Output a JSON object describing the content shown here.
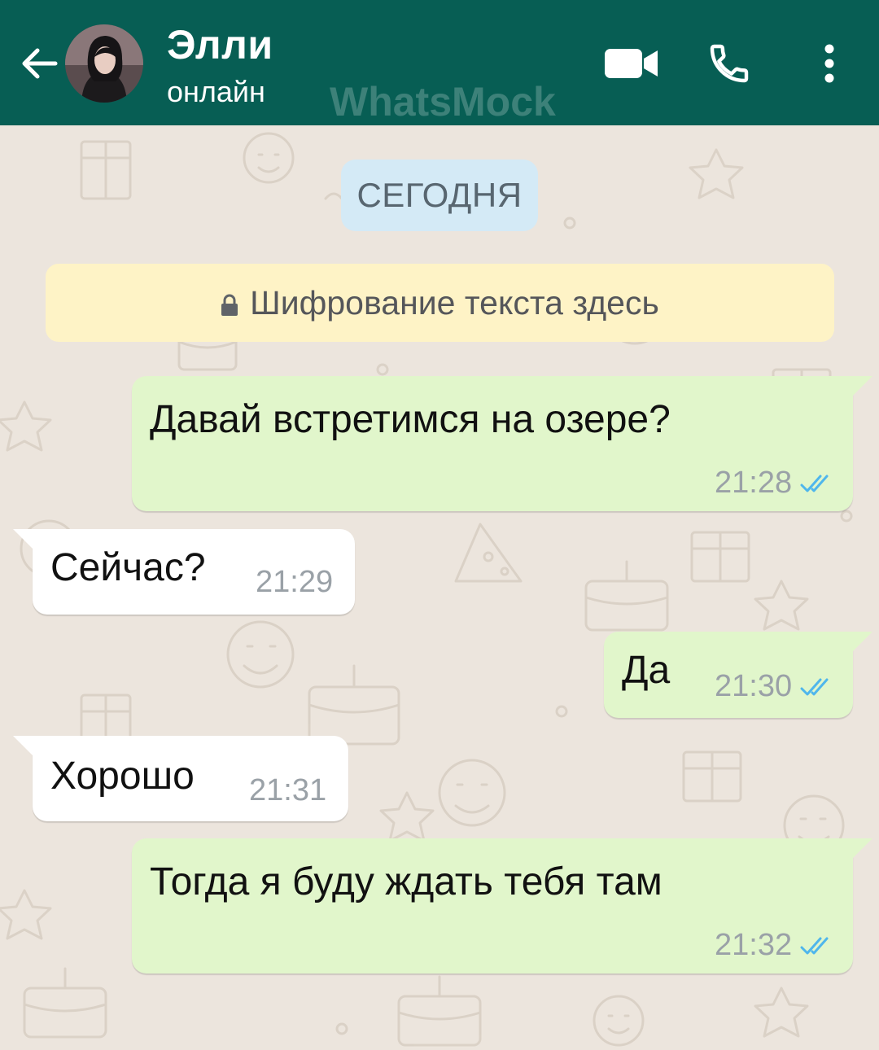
{
  "header": {
    "contact_name": "Элли",
    "contact_status": "онлайн",
    "watermark": "WhatsMock",
    "icons": [
      "back-arrow-icon",
      "avatar",
      "video-call-icon",
      "phone-icon",
      "more-vert-icon"
    ]
  },
  "chat": {
    "date_label": "СЕГОДНЯ",
    "encryption_notice": "Шифрование текста здесь",
    "messages": [
      {
        "direction": "outgoing",
        "text": "Давай встретимся на озере?",
        "time": "21:28",
        "status": "read"
      },
      {
        "direction": "incoming",
        "text": "Сейчас?",
        "time": "21:29"
      },
      {
        "direction": "outgoing",
        "text": "Да",
        "time": "21:30",
        "status": "read"
      },
      {
        "direction": "incoming",
        "text": "Хорошо",
        "time": "21:31"
      },
      {
        "direction": "outgoing",
        "text": "Тогда я буду ждать тебя там",
        "time": "21:32",
        "status": "read"
      }
    ]
  },
  "colors": {
    "header_bg": "#075e54",
    "chat_bg": "#ece5dd",
    "outgoing_bubble": "#e1f6cb",
    "incoming_bubble": "#ffffff",
    "date_pill": "#d4eaf6",
    "encryption_banner": "#fef3c6",
    "read_ticks": "#4fb6ec"
  }
}
